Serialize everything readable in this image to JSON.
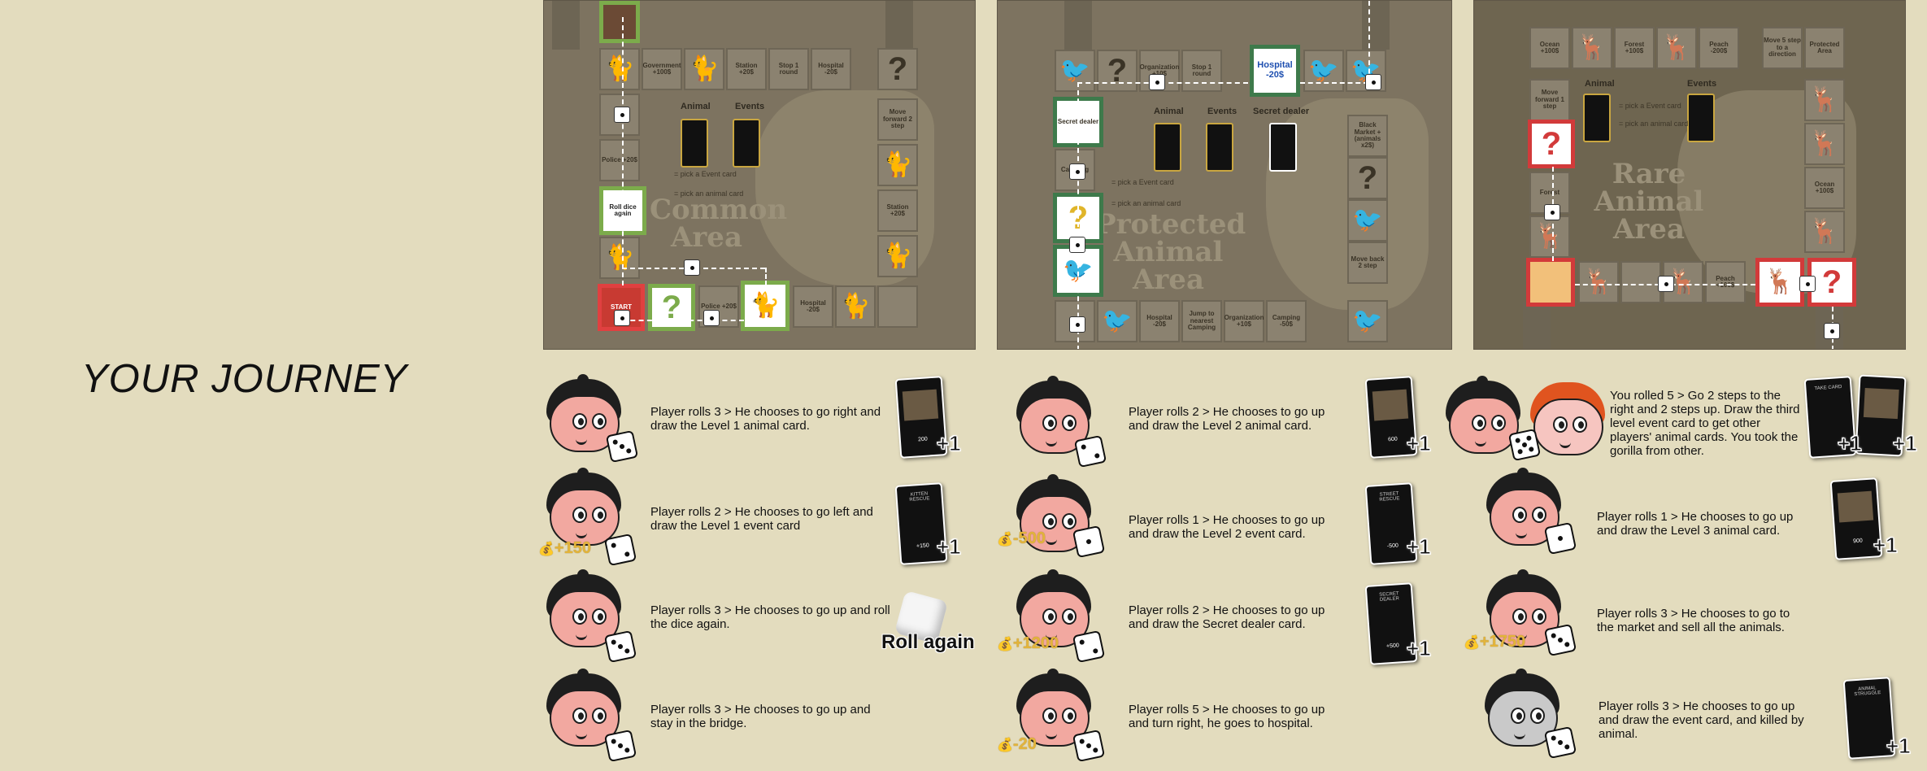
{
  "title": "YOUR JOURNEY",
  "boards": [
    {
      "area_label": "Common Area",
      "deck_labels": [
        "Animal",
        "Events"
      ],
      "pick_event": "= pick a Event card",
      "pick_animal": "= pick an animal card",
      "tiles": {
        "government": "Government +100$",
        "station1": "Station +20$",
        "stop_round": "Stop 1 round",
        "hospital1": "Hospital -20$",
        "police1": "Police +20$",
        "move_forward": "Move forward 2 step",
        "station2": "Station +20$",
        "roll_again": "Roll dice again",
        "start": "START",
        "police2": "Police +20$",
        "hospital2": "Hospital -20$"
      }
    },
    {
      "area_label": "Protected Animal Area",
      "deck_labels": [
        "Animal",
        "Events",
        "Secret dealer"
      ],
      "pick_event": "= pick a Event card",
      "pick_animal": "= pick an animal card",
      "tiles": {
        "organization": "Organization +10$",
        "stop_round": "Stop 1 round",
        "hospital_hl": "Hospital -20$",
        "secret_dealer": "Secret dealer",
        "camping1": "Camping",
        "black_market": "Black Market +(animals x2$)",
        "move_back": "Move back 2 step",
        "hospital2": "Hospital -20$",
        "jump": "Jump to nearest Camping",
        "organization2": "Organization +10$",
        "camping2": "Camping -50$"
      }
    },
    {
      "area_label": "Rare Animal Area",
      "deck_labels": [
        "Animal",
        "Events"
      ],
      "pick_event": "= pick a Event card",
      "pick_animal": "= pick an animal card",
      "tiles": {
        "ocean1": "Ocean +100$",
        "forest1": "Forest +100$",
        "peach1": "Peach -200$",
        "move5": "Move 5 step to a direction",
        "protected": "Protected Area",
        "move_forward": "Move forward 1 step",
        "forest2": "Forest",
        "ocean2": "Ocean +100$",
        "peach2": "Peach +100$"
      }
    }
  ],
  "steps": [
    {
      "text": "Player rolls 3 > He chooses to go right and draw the Level 1 animal card.",
      "money": "",
      "plus": "+1"
    },
    {
      "text": "Player rolls 2 > He chooses to go left and draw the Level 1 event card",
      "money": "+150",
      "plus": "+1"
    },
    {
      "text": "Player rolls 3 > He chooses to go up and roll the dice again.",
      "money": "",
      "plus": "Roll again"
    },
    {
      "text": "Player rolls 3 > He chooses to go up and stay in the bridge.",
      "money": "",
      "plus": ""
    },
    {
      "text": "Player rolls 2 > He chooses to go up and draw the Level 2 animal card.",
      "money": "",
      "plus": "+1"
    },
    {
      "text": "Player rolls 1 > He chooses to go up and draw the Level 2 event card.",
      "money": "-500",
      "plus": "+1"
    },
    {
      "text": "Player rolls 2 > He chooses to go up and draw the Secret dealer card.",
      "money": "+1200",
      "plus": "+1"
    },
    {
      "text": "Player rolls 5 > He chooses to go up and turn right, he goes to hospital.",
      "money": "-20",
      "plus": ""
    },
    {
      "text": "You rolled 5 > Go 2 steps to the right and 2 steps up. Draw the third level event card to get other players' animal cards. You took the gorilla from other.",
      "money": "",
      "plus": "+1"
    },
    {
      "text": "Player rolls 1 > He chooses to go up and draw the Level 3 animal card.",
      "money": "",
      "plus": "+1"
    },
    {
      "text": "Player rolls 3 > He chooses to go to the market and sell all the animals.",
      "money": "+1750",
      "plus": ""
    },
    {
      "text": "Player rolls 3 > He chooses to go up and draw the event card, and killed by animal.",
      "money": "",
      "plus": "+1"
    }
  ],
  "money_icon": "money-bag-icon",
  "colors": {
    "background": "#e3dcbe",
    "highlight_green": "#7cab4b",
    "highlight_red": "#d23a3a",
    "money": "#e3b43a"
  }
}
